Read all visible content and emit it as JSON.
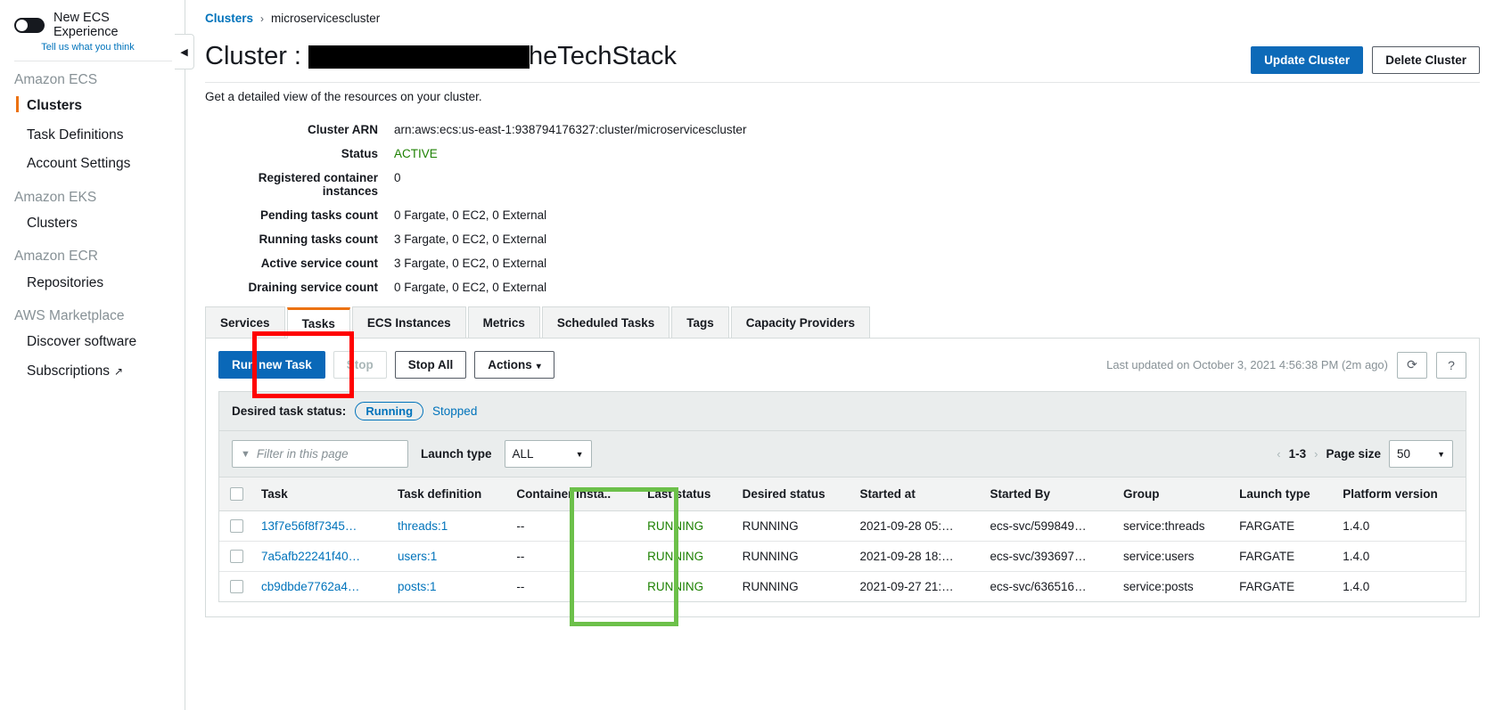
{
  "sidebar": {
    "new_experience_label": "New ECS Experience",
    "feedback_link": "Tell us what you think",
    "groups": [
      {
        "title": "Amazon ECS",
        "items": [
          {
            "label": "Clusters",
            "active": true
          },
          {
            "label": "Task Definitions",
            "active": false
          },
          {
            "label": "Account Settings",
            "active": false
          }
        ]
      },
      {
        "title": "Amazon EKS",
        "items": [
          {
            "label": "Clusters",
            "active": false
          }
        ]
      },
      {
        "title": "Amazon ECR",
        "items": [
          {
            "label": "Repositories",
            "active": false
          }
        ]
      },
      {
        "title": "AWS Marketplace",
        "items": [
          {
            "label": "Discover software",
            "active": false
          },
          {
            "label": "Subscriptions",
            "active": false,
            "external": true
          }
        ]
      }
    ],
    "collapse_icon": "◀"
  },
  "breadcrumb": {
    "root": "Clusters",
    "separator": "›",
    "current": "microservicescluster"
  },
  "header": {
    "title_prefix": "Cluster :",
    "title_redacted": true,
    "title_suffix": "heTechStack",
    "subtitle": "Get a detailed view of the resources on your cluster.",
    "update_button": "Update Cluster",
    "delete_button": "Delete Cluster"
  },
  "details": [
    {
      "label": "Cluster ARN",
      "value": "arn:aws:ecs:us-east-1:938794176327:cluster/microservicescluster",
      "status": false
    },
    {
      "label": "Status",
      "value": "ACTIVE",
      "status": true
    },
    {
      "label": "Registered container instances",
      "value": "0",
      "status": false
    },
    {
      "label": "Pending tasks count",
      "value": "0 Fargate, 0 EC2, 0 External",
      "status": false
    },
    {
      "label": "Running tasks count",
      "value": "3 Fargate, 0 EC2, 0 External",
      "status": false
    },
    {
      "label": "Active service count",
      "value": "3 Fargate, 0 EC2, 0 External",
      "status": false
    },
    {
      "label": "Draining service count",
      "value": "0 Fargate, 0 EC2, 0 External",
      "status": false
    }
  ],
  "tabs": [
    {
      "label": "Services",
      "active": false
    },
    {
      "label": "Tasks",
      "active": true
    },
    {
      "label": "ECS Instances",
      "active": false
    },
    {
      "label": "Metrics",
      "active": false
    },
    {
      "label": "Scheduled Tasks",
      "active": false
    },
    {
      "label": "Tags",
      "active": false
    },
    {
      "label": "Capacity Providers",
      "active": false
    }
  ],
  "toolbar": {
    "run_new_task": "Run new Task",
    "stop": "Stop",
    "stop_all": "Stop All",
    "actions": "Actions",
    "actions_caret": "▾",
    "last_updated": "Last updated on October 3, 2021 4:56:38 PM (2m ago)",
    "refresh_icon": "⟳",
    "help_icon": "?"
  },
  "status_filter": {
    "label": "Desired task status:",
    "running": "Running",
    "stopped": "Stopped"
  },
  "filter_bar": {
    "funnel_icon": "▼",
    "filter_placeholder": "Filter in this page",
    "launch_type_label": "Launch type",
    "launch_type_value": "ALL",
    "select_arrow": "▼",
    "prev_arrow": "‹",
    "page_range": "1-3",
    "next_arrow": "›",
    "page_size_label": "Page size",
    "page_size_value": "50"
  },
  "table": {
    "columns": [
      "Task",
      "Task definition",
      "Container insta..",
      "Last status",
      "Desired status",
      "Started at",
      "Started By",
      "Group",
      "Launch type",
      "Platform version"
    ],
    "rows": [
      {
        "task": "13f7e56f8f7345…",
        "task_definition": "threads:1",
        "container_instance": "--",
        "last_status": "RUNNING",
        "desired_status": "RUNNING",
        "started_at": "2021-09-28 05:…",
        "started_by": "ecs-svc/599849…",
        "group": "service:threads",
        "launch_type": "FARGATE",
        "platform_version": "1.4.0"
      },
      {
        "task": "7a5afb22241f40…",
        "task_definition": "users:1",
        "container_instance": "--",
        "last_status": "RUNNING",
        "desired_status": "RUNNING",
        "started_at": "2021-09-28 18:…",
        "started_by": "ecs-svc/393697…",
        "group": "service:users",
        "launch_type": "FARGATE",
        "platform_version": "1.4.0"
      },
      {
        "task": "cb9dbde7762a4…",
        "task_definition": "posts:1",
        "container_instance": "--",
        "last_status": "RUNNING",
        "desired_status": "RUNNING",
        "started_at": "2021-09-27 21:…",
        "started_by": "ecs-svc/636516…",
        "group": "service:posts",
        "launch_type": "FARGATE",
        "platform_version": "1.4.0"
      }
    ]
  },
  "annotations": {
    "tasks_tab_box_color": "#ff0000",
    "last_status_column_box_color": "#6cc04a"
  }
}
